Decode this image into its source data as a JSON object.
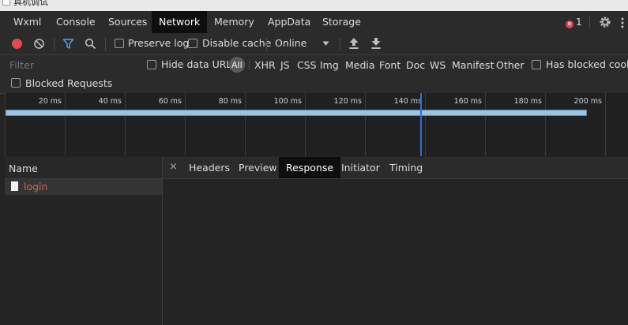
{
  "window": {
    "title": "真机调试"
  },
  "tabs": [
    {
      "label": "Wxml"
    },
    {
      "label": "Console"
    },
    {
      "label": "Sources"
    },
    {
      "label": "Network",
      "active": true
    },
    {
      "label": "Memory"
    },
    {
      "label": "AppData"
    },
    {
      "label": "Storage"
    }
  ],
  "status": {
    "error_count": "1",
    "error_icon": "error-x-icon"
  },
  "toolbar": {
    "preserve_log": "Preserve log",
    "disable_cache": "Disable cache",
    "throttle": "Online"
  },
  "filter": {
    "placeholder": "Filter",
    "hide_data_urls": "Hide data URLs",
    "types": [
      "All",
      "XHR",
      "JS",
      "CSS",
      "Img",
      "Media",
      "Font",
      "Doc",
      "WS",
      "Manifest",
      "Other"
    ],
    "has_blocked_cookies": "Has blocked cookies",
    "blocked_requests": "Blocked Requests"
  },
  "timeline": {
    "ticks": [
      "20 ms",
      "40 ms",
      "60 ms",
      "80 ms",
      "100 ms",
      "120 ms",
      "140 ms",
      "160 ms",
      "180 ms",
      "200 ms"
    ]
  },
  "requests": {
    "column_name": "Name",
    "items": [
      {
        "name": "login",
        "color": "#e0614f"
      }
    ]
  },
  "details": {
    "tabs": [
      "Headers",
      "Preview",
      "Response",
      "Initiator",
      "Timing"
    ],
    "active": "Response"
  },
  "colors": {
    "record_red": "#e5484d",
    "filter_blue": "#4aa3f0",
    "marker_blue": "#2f6fd6",
    "error_text": "#e0614f"
  }
}
